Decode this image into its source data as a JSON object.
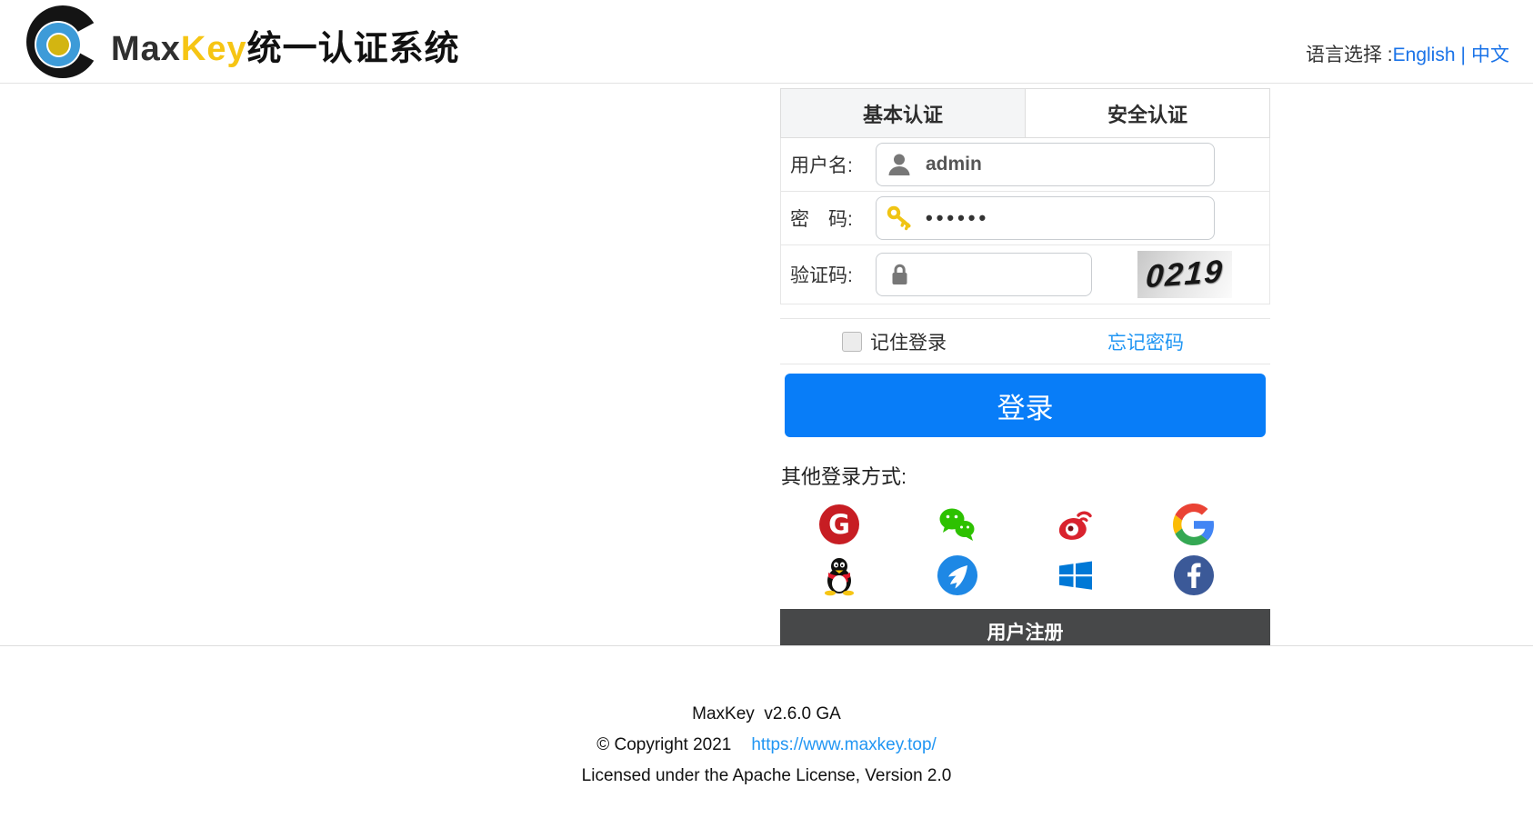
{
  "header": {
    "brand": {
      "max": "Max",
      "key": "Key",
      "suffix": "统一认证系统"
    },
    "language": {
      "label": "语言选择 :",
      "english": "English",
      "divider": "|",
      "chinese": "中文"
    }
  },
  "tabs": {
    "basic": "基本认证",
    "secure": "安全认证"
  },
  "form": {
    "username_label": "用户名:",
    "username_value": "admin",
    "password_label": "密　码:",
    "password_value": "••••••",
    "captcha_label": "验证码:",
    "captcha_value": "",
    "captcha_image_text": "0219",
    "remember_label": "记住登录",
    "forgot_label": "忘记密码",
    "submit_label": "登录"
  },
  "social": {
    "heading": "其他登录方式:",
    "providers": [
      "gitee",
      "wechat",
      "weibo",
      "google",
      "qq",
      "dingtalk",
      "windows",
      "facebook"
    ],
    "register_label": "用户注册"
  },
  "footer": {
    "version": "MaxKey  v2.6.0 GA",
    "copyright": "© Copyright 2021",
    "link": "https://www.maxkey.top/",
    "license": "Licensed under the Apache License, Version 2.0"
  },
  "colors": {
    "accent_blue": "#087df8",
    "link_blue": "#2196f3",
    "header_link_blue": "#1a73e8",
    "brand_yellow": "#f6c514",
    "register_bar": "#474849",
    "gitee_red": "#c71d23",
    "wechat_green": "#2dc100",
    "weibo_red": "#d9232e",
    "qq_black": "#10100e",
    "dingtalk_blue": "#1e88e5",
    "windows_blue": "#0078d6",
    "facebook_blue": "#3b5998"
  }
}
